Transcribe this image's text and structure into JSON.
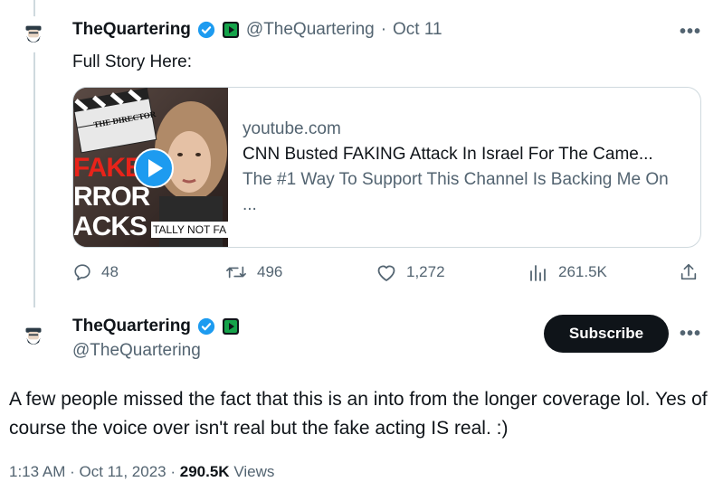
{
  "tweet1": {
    "display_name": "TheQuartering",
    "handle": "@TheQuartering",
    "separator": "·",
    "date": "Oct 11",
    "text": "Full Story Here:",
    "card": {
      "domain": "youtube.com",
      "title": "CNN Busted FAKING Attack In Israel For The Came...",
      "description": "The #1 Way To Support This Channel Is Backing Me On ...",
      "thumb_text_fake": "FAKE",
      "thumb_text_rror": "RROR",
      "thumb_text_acks": "ACKS",
      "thumb_text_banner": "TALLY NOT FA",
      "thumb_clapper_text": "THE DIRECTOR"
    },
    "actions": {
      "replies": "48",
      "reposts": "496",
      "likes": "1,272",
      "views": "261.5K"
    }
  },
  "tweet2": {
    "display_name": "TheQuartering",
    "handle": "@TheQuartering",
    "subscribe_label": "Subscribe",
    "text": "A few people missed the fact that this is an into from the longer coverage lol.  Yes of course the voice over isn't real but the fake acting IS real. :)",
    "time": "1:13 AM",
    "separator": "·",
    "date": "Oct 11, 2023",
    "views_count": "290.5K",
    "views_label": "Views"
  },
  "colors": {
    "verified": "#1d9bf0",
    "game_badge": "#15a34a",
    "text": "#0f1419",
    "muted": "#536471",
    "border": "#cfd9de"
  },
  "icons": {
    "more": "more-horizontal-icon",
    "reply": "reply-icon",
    "repost": "repost-icon",
    "like": "heart-icon",
    "views": "analytics-icon",
    "share": "share-icon"
  },
  "more_label": "•••"
}
